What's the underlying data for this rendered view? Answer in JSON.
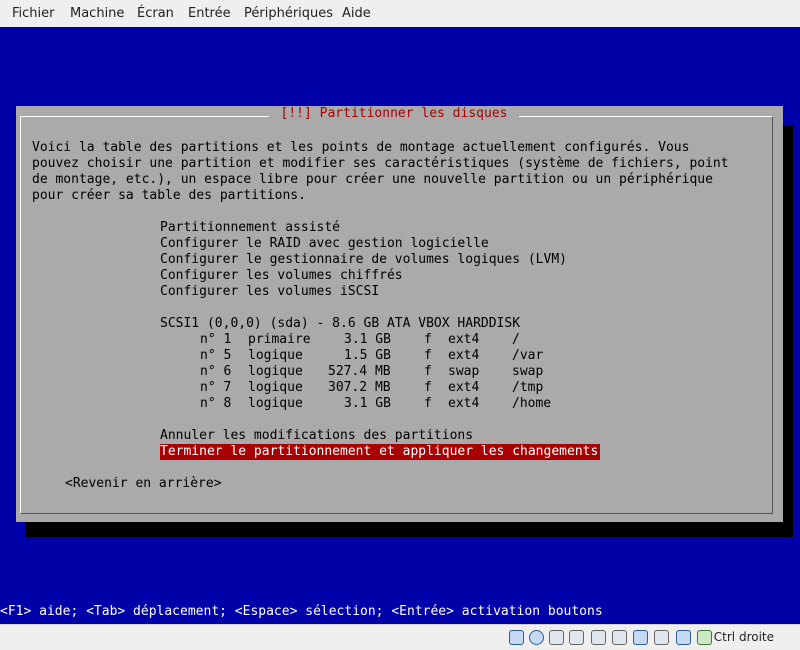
{
  "menubar": {
    "items": [
      "Fichier",
      "Machine",
      "Écran",
      "Entrée",
      "Périphériques",
      "Aide"
    ]
  },
  "dialog": {
    "title": "[!!] Partitionner les disques",
    "intro": [
      "Voici la table des partitions et les points de montage actuellement configurés. Vous",
      "pouvez choisir une partition et modifier ses caractéristiques (système de fichiers, point",
      "de montage, etc.), un espace libre pour créer une nouvelle partition ou un périphérique",
      "pour créer sa table des partitions."
    ],
    "options": [
      "Partitionnement assisté",
      "Configurer le RAID avec gestion logicielle",
      "Configurer le gestionnaire de volumes logiques (LVM)",
      "Configurer les volumes chiffrés",
      "Configurer les volumes iSCSI"
    ],
    "disk": "SCSI1 (0,0,0) (sda) - 8.6 GB ATA VBOX HARDDISK",
    "partitions": [
      {
        "num": "n° 1",
        "type": "primaire",
        "size": "3.1 GB",
        "flag": "f",
        "fs": "ext4",
        "mount": "/"
      },
      {
        "num": "n° 5",
        "type": "logique",
        "size": "1.5 GB",
        "flag": "f",
        "fs": "ext4",
        "mount": "/var"
      },
      {
        "num": "n° 6",
        "type": "logique",
        "size": "527.4 MB",
        "flag": "f",
        "fs": "swap",
        "mount": "swap"
      },
      {
        "num": "n° 7",
        "type": "logique",
        "size": "307.2 MB",
        "flag": "f",
        "fs": "ext4",
        "mount": "/tmp"
      },
      {
        "num": "n° 8",
        "type": "logique",
        "size": "3.1 GB",
        "flag": "f",
        "fs": "ext4",
        "mount": "/home"
      }
    ],
    "undo": "Annuler les modifications des partitions",
    "finish": "Terminer le partitionnement et appliquer les changements",
    "back": "<Revenir en arrière>"
  },
  "status_line": "<F1> aide; <Tab> déplacement; <Espace> sélection; <Entrée> activation boutons",
  "hostbar": {
    "host_key": "Ctrl droite"
  },
  "colors": {
    "screen_bg": "#0000a8",
    "dialog_bg": "#aaaaaa",
    "title_red": "#a80000",
    "selection_bg": "#a80000"
  }
}
